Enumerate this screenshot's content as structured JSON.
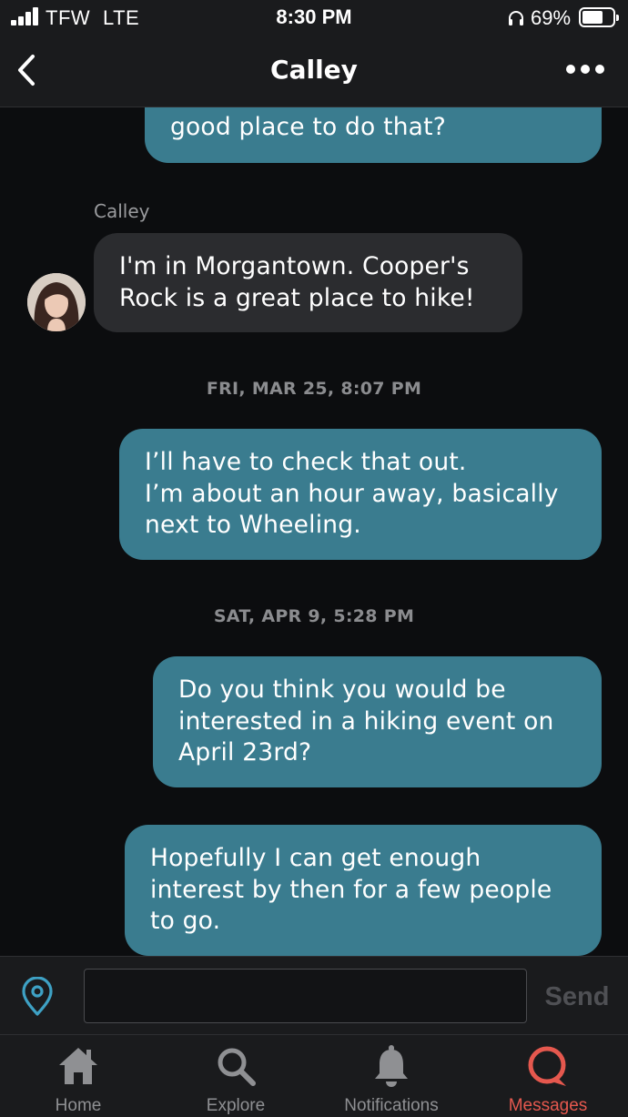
{
  "status_bar": {
    "carrier": "TFW",
    "network": "LTE",
    "time": "8:30 PM",
    "battery_percent": "69%",
    "battery_level": 0.69,
    "icons": [
      "signal-bars-icon",
      "headphones-icon",
      "battery-icon"
    ]
  },
  "header": {
    "title": "Calley",
    "back_icon": "chevron-left-icon",
    "more_icon": "more-dots-icon"
  },
  "conversation": {
    "msg_partial": {
      "lines": [
        "good place to do that?"
      ]
    },
    "sender_name": "Calley",
    "msg_incoming": {
      "lines": [
        "I'm in Morgantown. Cooper's",
        "Rock is a great place to hike!"
      ]
    },
    "timestamp_1": "FRI, MAR 25, 8:07 PM",
    "msg_out_1": {
      "lines": [
        "I’ll have to check that out.",
        "I’m about an hour away, basically",
        "next to Wheeling."
      ]
    },
    "timestamp_2": "SAT, APR 9, 5:28 PM",
    "msg_out_2": {
      "lines": [
        "Do you think you would be",
        "interested in a hiking event on",
        "April 23rd?"
      ]
    },
    "msg_out_3": {
      "lines": [
        "Hopefully I can get enough",
        "interest by then for a few people",
        "to go."
      ]
    }
  },
  "composer": {
    "input_value": "",
    "input_placeholder": "",
    "send_label": "Send",
    "location_icon": "location-pin-icon"
  },
  "tab_bar": {
    "home": "Home",
    "explore": "Explore",
    "notifications": "Notifications",
    "messages": "Messages",
    "active": "Messages"
  },
  "colors": {
    "outgoing_bubble": "#3a7c8f",
    "incoming_bubble": "#2b2c2f",
    "background": "#0c0d0f",
    "bar_background": "#1a1b1d",
    "active_tab": "#e5584e",
    "location_icon": "#3ea1c4"
  }
}
